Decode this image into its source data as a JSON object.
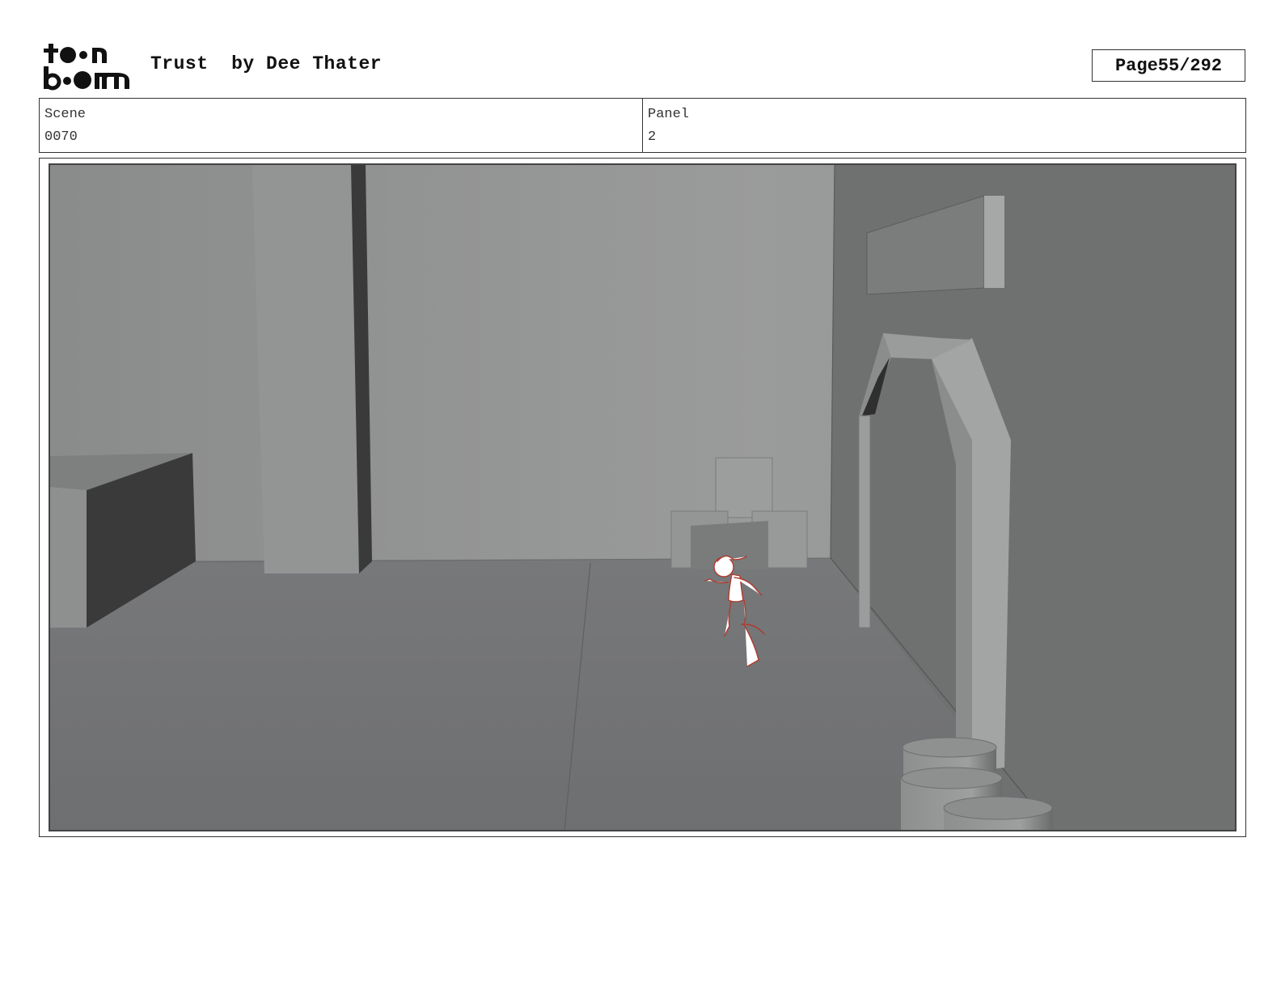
{
  "header": {
    "logo_text_top": "toon",
    "logo_text_bottom": "boom",
    "project_title": "Trust",
    "author": "by Dee Thater",
    "page_label": "Page",
    "page_number": "55/292"
  },
  "info": {
    "scene_label": "Scene",
    "scene_value": "0070",
    "panel_label": "Panel",
    "panel_value": "2"
  },
  "panel_image": {
    "content": "3d-greyscale-room-with-sketched-running-character",
    "sketch_color": "#b03a2e"
  }
}
